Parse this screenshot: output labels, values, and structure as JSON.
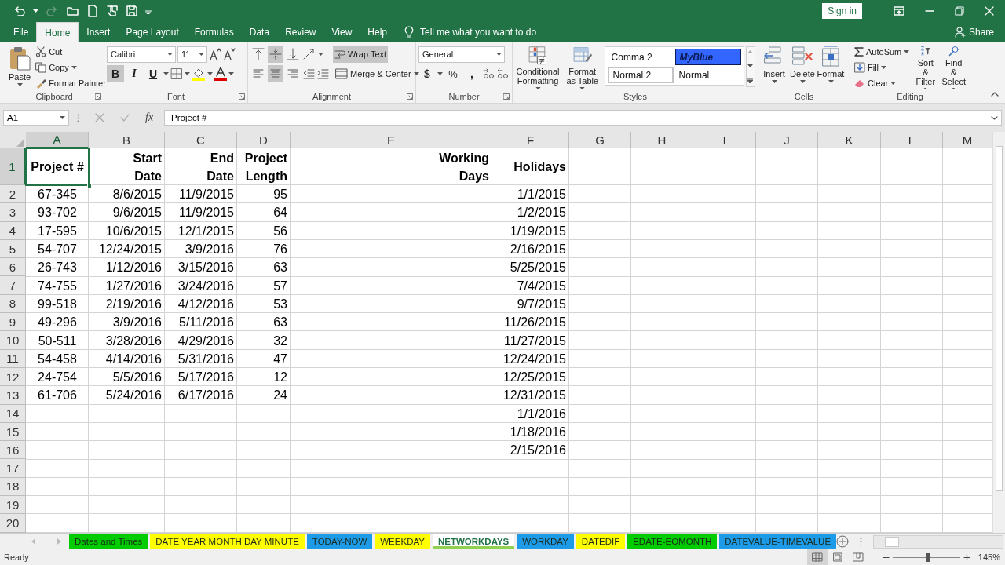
{
  "title_bar": {
    "sign_in": "Sign in"
  },
  "ribbon_tabs": [
    {
      "label": "File",
      "selected": false
    },
    {
      "label": "Home",
      "selected": true
    },
    {
      "label": "Insert",
      "selected": false
    },
    {
      "label": "Page Layout",
      "selected": false
    },
    {
      "label": "Formulas",
      "selected": false
    },
    {
      "label": "Data",
      "selected": false
    },
    {
      "label": "Review",
      "selected": false
    },
    {
      "label": "View",
      "selected": false
    },
    {
      "label": "Help",
      "selected": false
    }
  ],
  "tell_me": {
    "placeholder": "Tell me what you want to do"
  },
  "share": "Share",
  "clipboard": {
    "label": "Clipboard",
    "paste": "Paste",
    "cut": "Cut",
    "copy": "Copy",
    "format_painter": "Format Painter"
  },
  "font": {
    "label": "Font",
    "font_name": "Calibri",
    "font_size": "11",
    "bold": {
      "label": "B",
      "selected": true
    },
    "italic": {
      "label": "I",
      "selected": false
    },
    "underline": {
      "label": "U",
      "selected": false
    }
  },
  "alignment": {
    "label": "Alignment",
    "vertical": [
      {
        "selected": false
      },
      {
        "selected": true
      },
      {
        "selected": false
      }
    ],
    "horizontal": [
      {
        "selected": false
      },
      {
        "selected": true
      },
      {
        "selected": false
      }
    ],
    "wrap_text": {
      "label": "Wrap Text",
      "selected": true
    },
    "merge_center": {
      "label": "Merge & Center",
      "selected": false
    }
  },
  "number": {
    "label": "Number",
    "format": "General",
    "currency": "$",
    "percent": "%",
    "comma": ","
  },
  "styles": {
    "label": "Styles",
    "conditional_formatting": "Conditional Formatting",
    "format_as_table": "Format as Table",
    "cell_styles": [
      {
        "label": "Comma 2",
        "kind": "plain"
      },
      {
        "label": "MyBlue",
        "kind": "blue"
      },
      {
        "label": "Normal 2",
        "kind": "framed"
      },
      {
        "label": "Normal",
        "kind": "plain"
      }
    ]
  },
  "cells": {
    "label": "Cells",
    "buttons": [
      "Insert",
      "Delete",
      "Format"
    ]
  },
  "editing": {
    "label": "Editing",
    "autosum": "AutoSum",
    "fill": "Fill",
    "clear": "Clear",
    "sort_filter": "Sort & Filter",
    "find_select": "Find & Select"
  },
  "formula_bar": {
    "name_box": "A1",
    "function_label": "fx",
    "formula": "Project #"
  },
  "sheet": {
    "columns": [
      {
        "label": "A",
        "selected": true
      },
      {
        "label": "B",
        "selected": false
      },
      {
        "label": "C",
        "selected": false
      },
      {
        "label": "D",
        "selected": false
      },
      {
        "label": "E",
        "selected": false
      },
      {
        "label": "F",
        "selected": false
      },
      {
        "label": "G",
        "selected": false
      },
      {
        "label": "H",
        "selected": false
      },
      {
        "label": "I",
        "selected": false
      },
      {
        "label": "J",
        "selected": false
      },
      {
        "label": "K",
        "selected": false
      },
      {
        "label": "L",
        "selected": false
      },
      {
        "label": "M",
        "selected": false
      }
    ],
    "rows": [
      {
        "label": "1",
        "selected": true,
        "cells": {
          "A": "Project #",
          "B": "Start\nDate",
          "C": "End\nDate",
          "D": "Project\nLength",
          "E": "Working\nDays",
          "F": "Holidays"
        }
      },
      {
        "label": "2",
        "selected": false,
        "cells": {
          "A": "67-345",
          "B": "8/6/2015",
          "C": "11/9/2015",
          "D": "95",
          "F": "1/1/2015"
        }
      },
      {
        "label": "3",
        "selected": false,
        "cells": {
          "A": "93-702",
          "B": "9/6/2015",
          "C": "11/9/2015",
          "D": "64",
          "F": "1/2/2015"
        }
      },
      {
        "label": "4",
        "selected": false,
        "cells": {
          "A": "17-595",
          "B": "10/6/2015",
          "C": "12/1/2015",
          "D": "56",
          "F": "1/19/2015"
        }
      },
      {
        "label": "5",
        "selected": false,
        "cells": {
          "A": "54-707",
          "B": "12/24/2015",
          "C": "3/9/2016",
          "D": "76",
          "F": "2/16/2015"
        }
      },
      {
        "label": "6",
        "selected": false,
        "cells": {
          "A": "26-743",
          "B": "1/12/2016",
          "C": "3/15/2016",
          "D": "63",
          "F": "5/25/2015"
        }
      },
      {
        "label": "7",
        "selected": false,
        "cells": {
          "A": "74-755",
          "B": "1/27/2016",
          "C": "3/24/2016",
          "D": "57",
          "F": "7/4/2015"
        }
      },
      {
        "label": "8",
        "selected": false,
        "cells": {
          "A": "99-518",
          "B": "2/19/2016",
          "C": "4/12/2016",
          "D": "53",
          "F": "9/7/2015"
        }
      },
      {
        "label": "9",
        "selected": false,
        "cells": {
          "A": "49-296",
          "B": "3/9/2016",
          "C": "5/11/2016",
          "D": "63",
          "F": "11/26/2015"
        }
      },
      {
        "label": "10",
        "selected": false,
        "cells": {
          "A": "50-511",
          "B": "3/28/2016",
          "C": "4/29/2016",
          "D": "32",
          "F": "11/27/2015"
        }
      },
      {
        "label": "11",
        "selected": false,
        "cells": {
          "A": "54-458",
          "B": "4/14/2016",
          "C": "5/31/2016",
          "D": "47",
          "F": "12/24/2015"
        }
      },
      {
        "label": "12",
        "selected": false,
        "cells": {
          "A": "24-754",
          "B": "5/5/2016",
          "C": "5/17/2016",
          "D": "12",
          "F": "12/25/2015"
        }
      },
      {
        "label": "13",
        "selected": false,
        "cells": {
          "A": "61-706",
          "B": "5/24/2016",
          "C": "6/17/2016",
          "D": "24",
          "F": "12/31/2015"
        }
      },
      {
        "label": "14",
        "selected": false,
        "cells": {
          "F": "1/1/2016"
        }
      },
      {
        "label": "15",
        "selected": false,
        "cells": {
          "F": "1/18/2016"
        }
      },
      {
        "label": "16",
        "selected": false,
        "cells": {
          "F": "2/15/2016"
        }
      },
      {
        "label": "17",
        "selected": false
      },
      {
        "label": "18",
        "selected": false
      },
      {
        "label": "19",
        "selected": false
      },
      {
        "label": "20",
        "selected": false
      }
    ]
  },
  "sheet_tabs": [
    {
      "label": "Dates and Times",
      "color": "#00cc00",
      "selected": false
    },
    {
      "label": "DATE YEAR MONTH DAY MINUTE",
      "color": "#ffff00",
      "selected": false
    },
    {
      "label": "TODAY-NOW",
      "color": "#1e9be8",
      "selected": false
    },
    {
      "label": "WEEKDAY",
      "color": "#ffff00",
      "selected": false
    },
    {
      "label": "NETWORKDAYS",
      "color": "#92d050",
      "selected": true
    },
    {
      "label": "WORKDAY",
      "color": "#1e9be8",
      "selected": false
    },
    {
      "label": "DATEDIF",
      "color": "#ffff00",
      "selected": false
    },
    {
      "label": "EDATE-EOMONTH",
      "color": "#00cc00",
      "selected": false
    },
    {
      "label": "DATEVALUE-TIMEVALUE",
      "color": "#1e9be8",
      "selected": false
    }
  ],
  "status_bar": {
    "status": "Ready",
    "views": [
      {
        "selected": true
      },
      {
        "selected": false
      },
      {
        "selected": false
      }
    ],
    "zoom": {
      "level": 0.53,
      "reading": "145%"
    }
  }
}
